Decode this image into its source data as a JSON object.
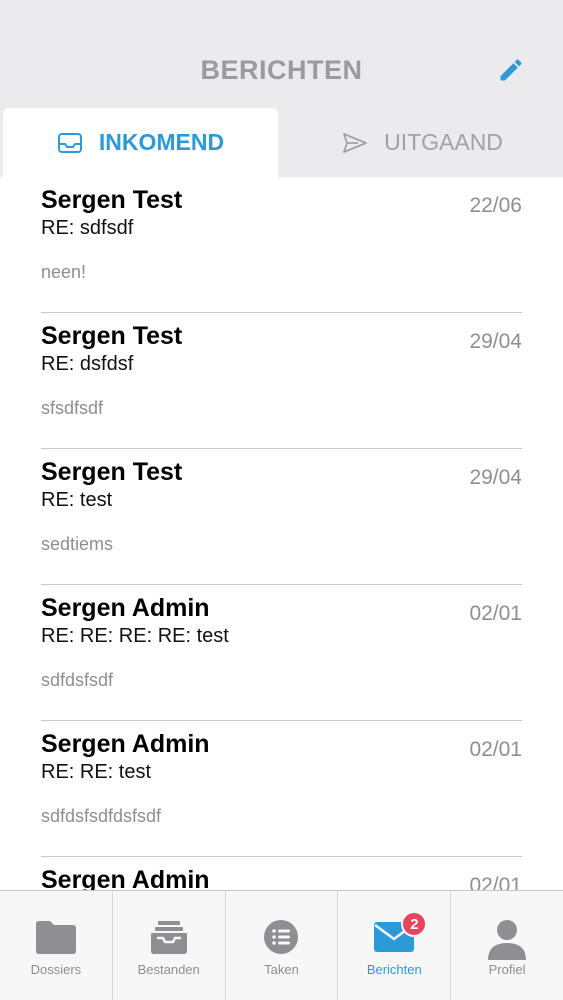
{
  "header": {
    "title": "BERICHTEN",
    "compose_icon": "pencil-icon"
  },
  "tabs": [
    {
      "label": "INKOMEND",
      "icon": "inbox-icon",
      "active": true
    },
    {
      "label": "UITGAAND",
      "icon": "send-icon",
      "active": false
    }
  ],
  "messages": [
    {
      "sender": "Sergen Test",
      "subject": "RE: sdfsdf",
      "preview": "neen!",
      "date": "22/06"
    },
    {
      "sender": "Sergen Test",
      "subject": "RE: dsfdsf",
      "preview": "sfsdfsdf",
      "date": "29/04"
    },
    {
      "sender": "Sergen Test",
      "subject": "RE: test",
      "preview": "sedtiems",
      "date": "29/04"
    },
    {
      "sender": "Sergen Admin",
      "subject": "RE: RE: RE: RE: test",
      "preview": "sdfdsfsdf",
      "date": "02/01"
    },
    {
      "sender": "Sergen Admin",
      "subject": "RE: RE: test",
      "preview": "sdfdsfsdfdsfsdf",
      "date": "02/01"
    },
    {
      "sender": "Sergen Admin",
      "subject": "",
      "preview": "",
      "date": "02/01"
    }
  ],
  "tabbar": {
    "items": [
      {
        "label": "Dossiers",
        "icon": "folder-icon"
      },
      {
        "label": "Bestanden",
        "icon": "tray-icon"
      },
      {
        "label": "Taken",
        "icon": "list-icon"
      },
      {
        "label": "Berichten",
        "icon": "mail-icon",
        "badge": "2",
        "active": true
      },
      {
        "label": "Profiel",
        "icon": "person-icon"
      }
    ]
  },
  "colors": {
    "accent": "#2d9ad8",
    "badge": "#e8445e",
    "header_bg": "#ebebed",
    "muted": "#8e8e93"
  }
}
